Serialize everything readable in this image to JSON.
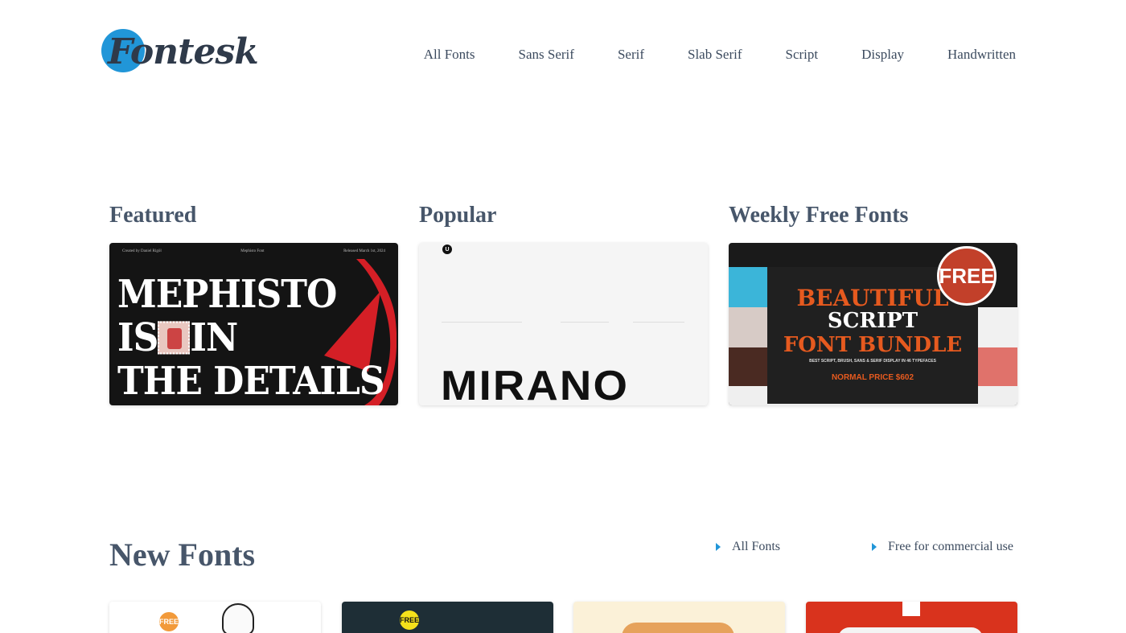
{
  "brand": {
    "logo_text": "Fontesk",
    "accent": "#2196d8"
  },
  "nav": [
    "All Fonts",
    "Sans Serif",
    "Serif",
    "Slab Serif",
    "Script",
    "Display",
    "Handwritten"
  ],
  "sections": {
    "featured": {
      "title": "Featured",
      "card_meta": [
        "Created by Daniel Rigöl",
        "Mephisto Font",
        "Released March 1st, 2024"
      ],
      "card_lines": [
        "MEPHISTO",
        "IS",
        "IN",
        "THE DETAILS"
      ]
    },
    "popular": {
      "title": "Popular",
      "card_badge": "U",
      "card_word": "MIRANO"
    },
    "weekly": {
      "title": "Weekly Free Fonts",
      "card_badge": "FREE",
      "card_lines": [
        "BEAUTIFUL",
        "SCRIPT",
        "FONT BUNDLE"
      ],
      "card_sub": "BEST SCRIPT, BRUSH, SANS & SERIF DISPLAY IN 46 TYPEFACES",
      "card_price": "NORMAL PRICE $602"
    }
  },
  "new_fonts": {
    "title": "New Fonts",
    "links": [
      "All Fonts",
      "Free for commercial use"
    ],
    "thumb_badges": [
      "FREE",
      "FREE"
    ]
  }
}
